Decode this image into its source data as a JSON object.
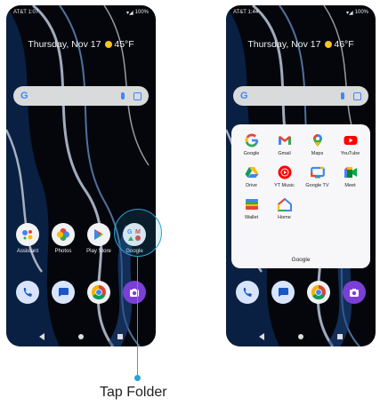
{
  "left_screen": {
    "carrier_time": "AT&T 1:07",
    "status_right": "100%",
    "date": "Thursday, Nov 17",
    "temperature": "45°F",
    "search_letter": "G",
    "apps": [
      {
        "label": "Assistant"
      },
      {
        "label": "Photos"
      },
      {
        "label": "Play Store"
      },
      {
        "label": "Google"
      }
    ],
    "dock": [
      "phone-icon",
      "messages-icon",
      "chrome-icon",
      "camera-icon"
    ]
  },
  "right_screen": {
    "carrier_time": "AT&T 1:44",
    "status_right": "100%",
    "date": "Thursday, Nov 17",
    "temperature": "46°F",
    "search_letter": "G",
    "folder": {
      "name": "Google",
      "apps": [
        {
          "label": "Google",
          "icon": "google-g-icon"
        },
        {
          "label": "Gmail",
          "icon": "gmail-icon"
        },
        {
          "label": "Maps",
          "icon": "maps-icon"
        },
        {
          "label": "YouTube",
          "icon": "youtube-icon"
        },
        {
          "label": "Drive",
          "icon": "drive-icon"
        },
        {
          "label": "YT Music",
          "icon": "yt-music-icon"
        },
        {
          "label": "Google TV",
          "icon": "google-tv-icon"
        },
        {
          "label": "Meet",
          "icon": "meet-icon"
        },
        {
          "label": "Wallet",
          "icon": "wallet-icon"
        },
        {
          "label": "Home",
          "icon": "home-icon"
        }
      ]
    }
  },
  "callout": {
    "text": "Tap Folder"
  },
  "colors": {
    "accent": "#2aa3d6",
    "google_blue": "#4285f4"
  }
}
